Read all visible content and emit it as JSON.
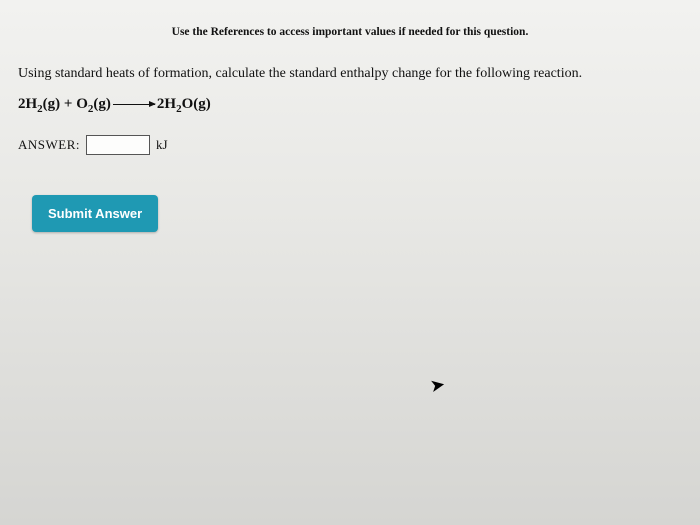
{
  "hint": "Use the References to access important values if needed for this question.",
  "question": "Using standard heats of formation, calculate the standard enthalpy change for the following reaction.",
  "equation": {
    "reactant1_coef": "2H",
    "reactant1_sub": "2",
    "reactant1_state": "(g)",
    "plus": " + ",
    "reactant2": "O",
    "reactant2_sub": "2",
    "reactant2_state": "(g)",
    "product_coef": "2H",
    "product_sub1": "2",
    "product_mid": "O",
    "product_state": "(g)"
  },
  "answer": {
    "label": "ANSWER:",
    "value": "",
    "unit": "kJ"
  },
  "submit": "Submit Answer"
}
